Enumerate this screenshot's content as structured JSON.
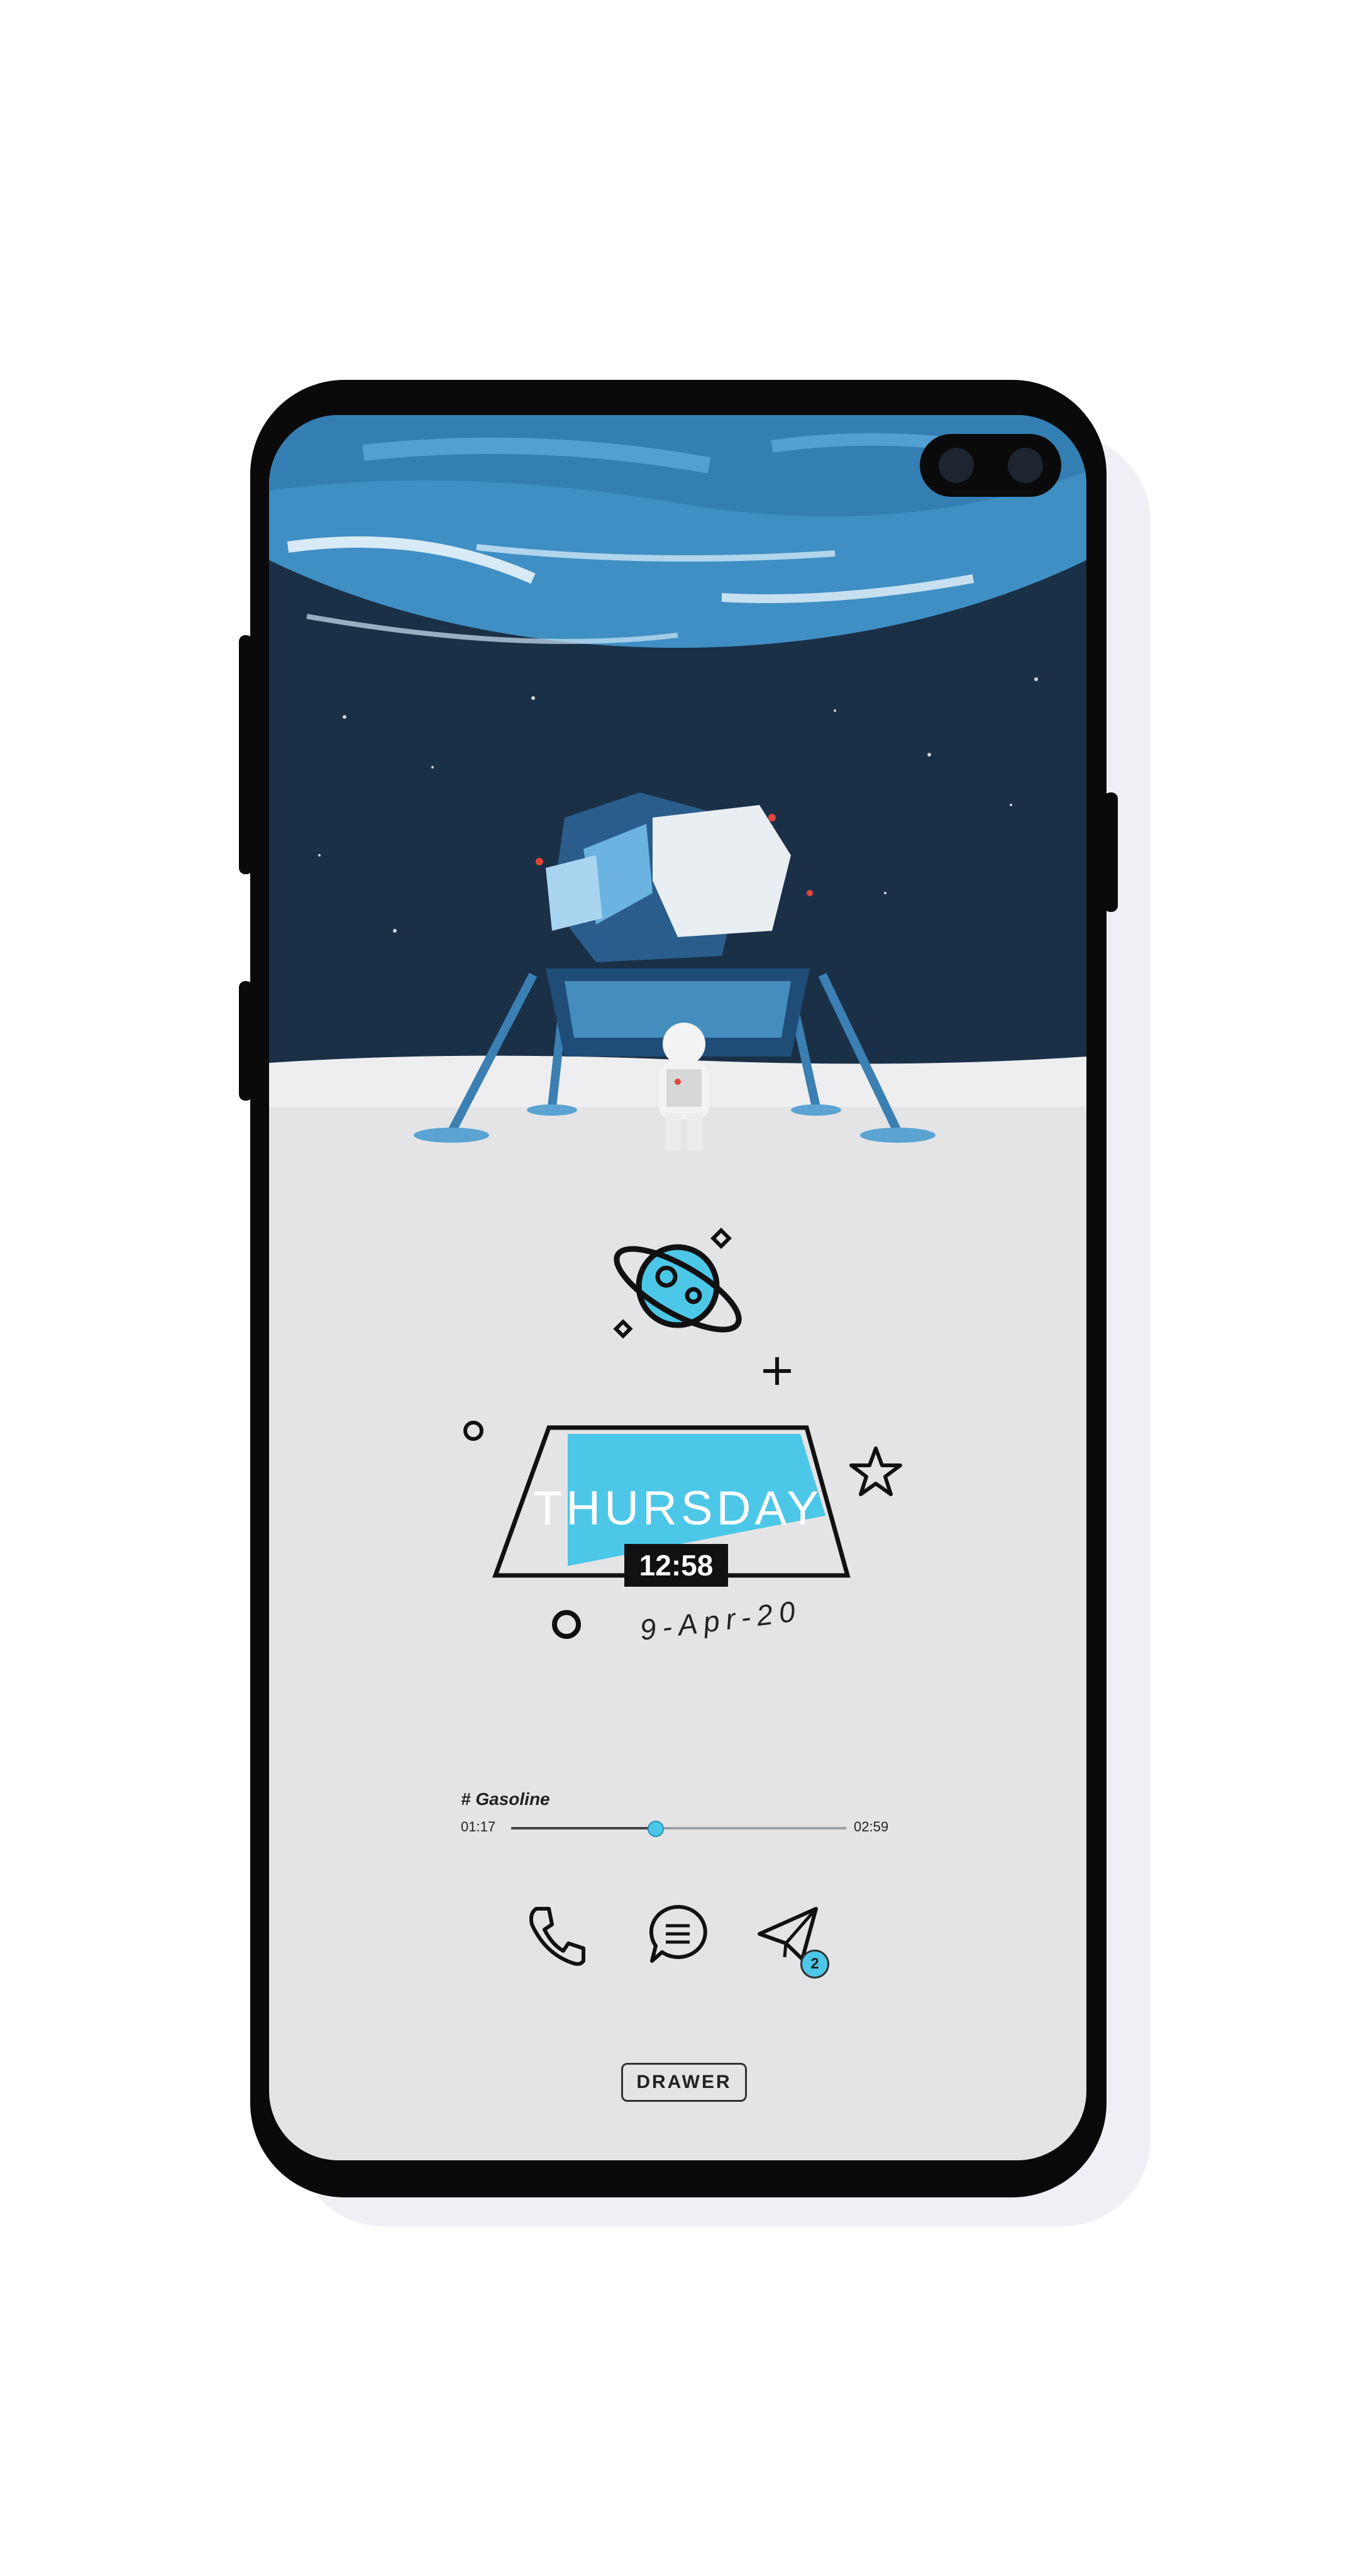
{
  "clock": {
    "day": "THURSDAY",
    "time": "12:58",
    "date": "9-Apr-20"
  },
  "music": {
    "song": "# Gasoline",
    "elapsed": "01:17",
    "duration": "02:59",
    "progress": 0.43
  },
  "dock": {
    "phone_icon": "phone-icon",
    "messages_icon": "chat-bubble-icon",
    "telegram_icon": "paper-plane-icon",
    "telegram_badge": "2"
  },
  "drawer": {
    "label": "DRAWER"
  },
  "colors": {
    "accent": "#4cc7e8",
    "screen_bg": "#e4e4e6",
    "sky": "#1a3047",
    "planet": "#3f8fc4"
  }
}
